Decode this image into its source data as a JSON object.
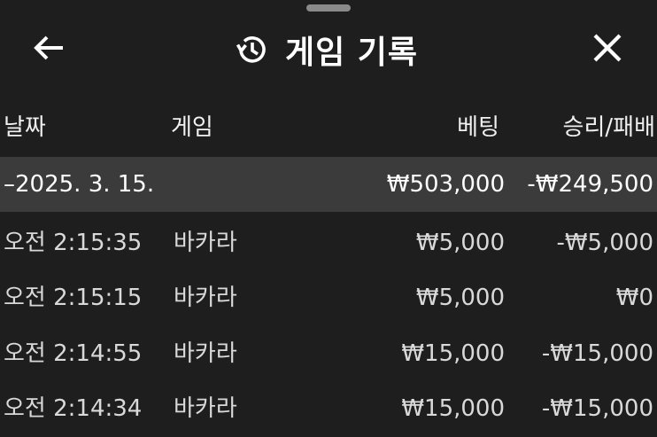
{
  "header": {
    "title": "게임 기록",
    "back_icon": "arrow-left-icon",
    "history_icon": "history-icon",
    "close_icon": "close-icon"
  },
  "columns": {
    "date": "날짜",
    "game": "게임",
    "bet": "베팅",
    "result": "승리/패배"
  },
  "date_group": {
    "date": "–2025. 3. 15.",
    "bet_total": "₩503,000",
    "result_total": "-₩249,500"
  },
  "rows": [
    {
      "time": "오전 2:15:35",
      "game": "바카라",
      "bet": "₩5,000",
      "result": "-₩5,000"
    },
    {
      "time": "오전 2:15:15",
      "game": "바카라",
      "bet": "₩5,000",
      "result": "₩0"
    },
    {
      "time": "오전 2:14:55",
      "game": "바카라",
      "bet": "₩15,000",
      "result": "-₩15,000"
    },
    {
      "time": "오전 2:14:34",
      "game": "바카라",
      "bet": "₩15,000",
      "result": "-₩15,000"
    }
  ]
}
